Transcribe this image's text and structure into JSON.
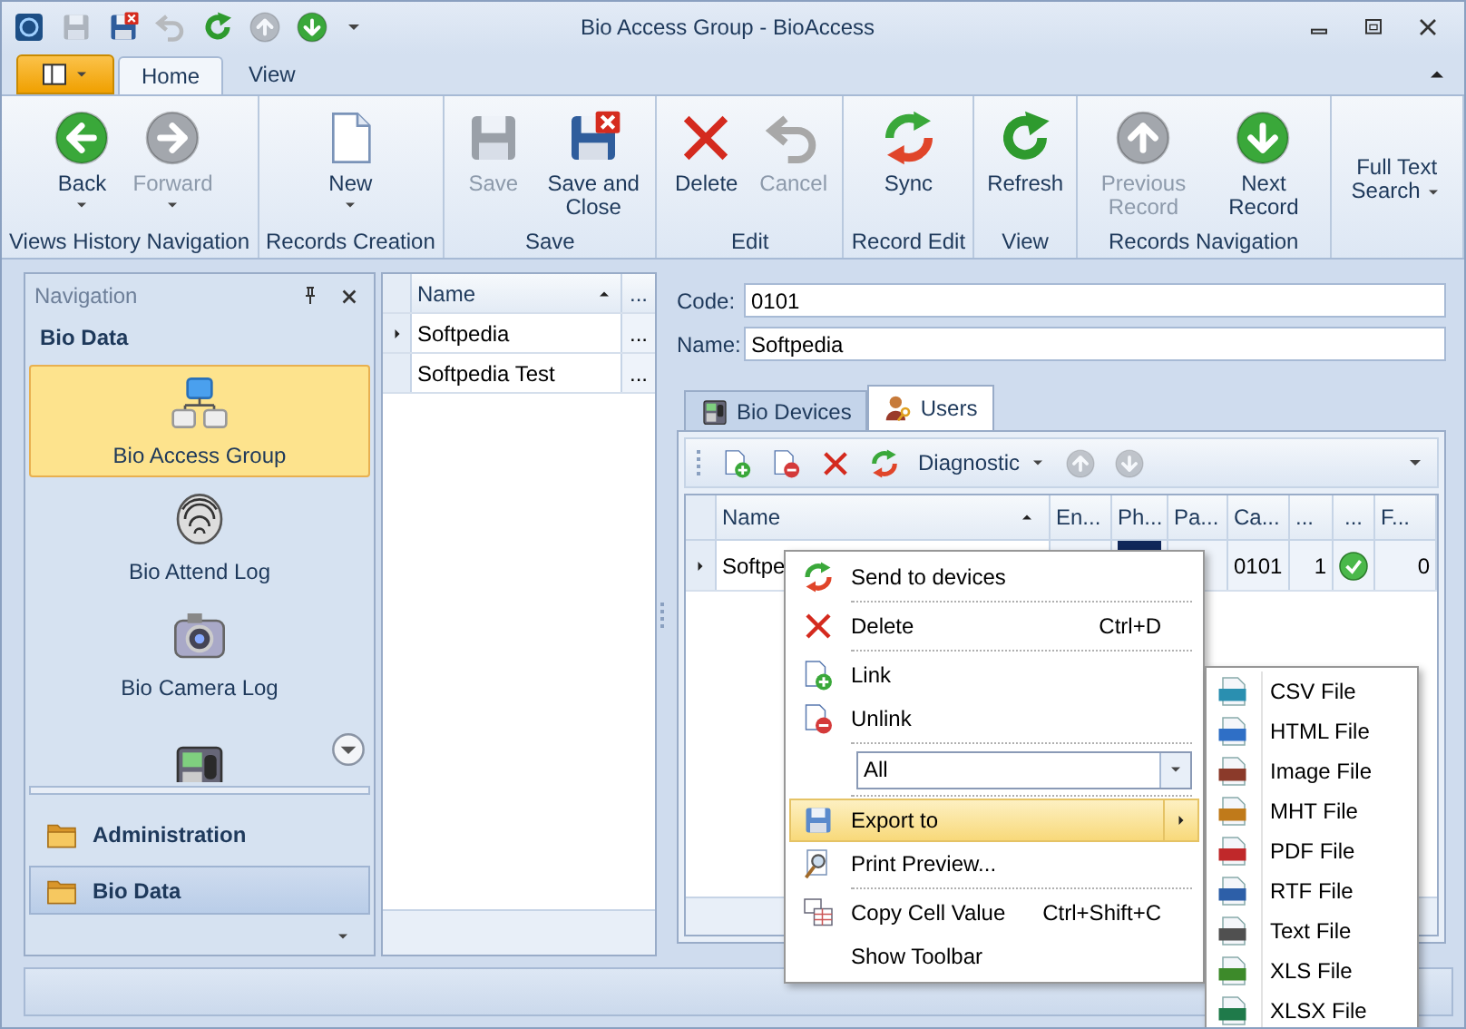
{
  "window": {
    "title": "Bio Access Group - BioAccess"
  },
  "quick_access": [
    {
      "kind": "app",
      "disabled": false
    },
    {
      "kind": "save",
      "disabled": true
    },
    {
      "kind": "save-close",
      "disabled": false
    },
    {
      "kind": "undo",
      "disabled": true
    },
    {
      "kind": "refresh",
      "disabled": false
    },
    {
      "kind": "up",
      "disabled": true
    },
    {
      "kind": "down",
      "disabled": false
    },
    {
      "kind": "customize",
      "disabled": false
    }
  ],
  "ribbon_tabs": [
    {
      "label": "Home",
      "selected": true
    },
    {
      "label": "View",
      "selected": false
    }
  ],
  "ribbon_groups": [
    {
      "label": "Views History Navigation",
      "buttons": [
        {
          "kind": "back",
          "label": "Back",
          "disabled": false,
          "dropdown": true
        },
        {
          "kind": "forward",
          "label": "Forward",
          "disabled": true,
          "dropdown": true
        }
      ]
    },
    {
      "label": "Records Creation",
      "buttons": [
        {
          "kind": "new",
          "label": "New",
          "disabled": false,
          "dropdown": true
        }
      ]
    },
    {
      "label": "Save",
      "buttons": [
        {
          "kind": "save",
          "label": "Save",
          "disabled": true,
          "dropdown": false
        },
        {
          "kind": "save-close",
          "label": "Save and Close",
          "disabled": false,
          "dropdown": false
        }
      ]
    },
    {
      "label": "Edit",
      "buttons": [
        {
          "kind": "delete",
          "label": "Delete",
          "disabled": false,
          "dropdown": false
        },
        {
          "kind": "undo",
          "label": "Cancel",
          "disabled": true,
          "dropdown": false
        }
      ]
    },
    {
      "label": "Record Edit",
      "buttons": [
        {
          "kind": "sync",
          "label": "Sync",
          "disabled": false,
          "dropdown": false
        }
      ]
    },
    {
      "label": "View",
      "buttons": [
        {
          "kind": "refresh",
          "label": "Refresh",
          "disabled": false,
          "dropdown": false
        }
      ]
    },
    {
      "label": "Records Navigation",
      "buttons": [
        {
          "kind": "up",
          "label": "Previous Record",
          "disabled": true,
          "dropdown": false
        },
        {
          "kind": "down",
          "label": "Next Record",
          "disabled": false,
          "dropdown": false
        }
      ]
    },
    {
      "buttons": [
        {
          "kind": "text",
          "label": "Full Text Search",
          "disabled": false,
          "dropdown": true
        }
      ]
    }
  ],
  "navigation": {
    "title": "Navigation",
    "group": "Bio Data",
    "items": [
      {
        "kind": "hierarchy",
        "label": "Bio Access Group",
        "selected": true
      },
      {
        "kind": "fingerprint",
        "label": "Bio Attend Log",
        "selected": false
      },
      {
        "kind": "camera",
        "label": "Bio Camera Log",
        "selected": false
      },
      {
        "kind": "terminal",
        "selected": false
      }
    ],
    "sections": [
      {
        "label": "Administration",
        "selected": false
      },
      {
        "label": "Bio Data",
        "selected": true
      }
    ]
  },
  "list": {
    "columns": [
      "Name",
      "..."
    ],
    "rows": [
      {
        "cells": [
          "Softpedia",
          "..."
        ],
        "current": true
      },
      {
        "cells": [
          "Softpedia Test",
          "..."
        ],
        "current": false
      }
    ]
  },
  "detail": {
    "fields": [
      {
        "label": "Code:",
        "value": "0101"
      },
      {
        "label": "Name:",
        "value": "Softpedia"
      }
    ],
    "tabs": [
      {
        "kind": "device",
        "label": "Bio Devices",
        "selected": false
      },
      {
        "kind": "users",
        "label": "Users",
        "selected": true
      }
    ],
    "toolbar": [
      {
        "kind": "link",
        "disabled": false
      },
      {
        "kind": "unlink",
        "disabled": false
      },
      {
        "kind": "delete",
        "disabled": false
      },
      {
        "kind": "sync",
        "disabled": false
      },
      {
        "kind": "dropdown",
        "label": "Diagnostic",
        "disabled": false
      },
      {
        "kind": "up",
        "disabled": true
      },
      {
        "kind": "down",
        "disabled": true
      }
    ],
    "grid": {
      "columns": [
        "Name",
        "En...",
        "Ph...",
        "Pa...",
        "Ca...",
        "...",
        "...",
        "F..."
      ],
      "rows": [
        {
          "current": true,
          "cells": [
            {
              "kind": "text",
              "text": "Softpe"
            },
            {
              "kind": "empty"
            },
            {
              "kind": "photo"
            },
            {
              "kind": "empty"
            },
            {
              "kind": "text",
              "text": "0101"
            },
            {
              "kind": "number",
              "text": "1"
            },
            {
              "kind": "check"
            },
            {
              "kind": "number",
              "text": "0"
            }
          ]
        }
      ]
    }
  },
  "context_menu": {
    "items": [
      {
        "kind": "sync",
        "label": "Send to devices",
        "selected": false,
        "separator_after": true
      },
      {
        "kind": "delete",
        "label": "Delete",
        "shortcut": "Ctrl+D",
        "selected": false,
        "separator_after": true
      },
      {
        "kind": "link",
        "label": "Link",
        "selected": false,
        "separator_after": false
      },
      {
        "kind": "unlink",
        "label": "Unlink",
        "selected": false,
        "separator_after": true
      },
      {
        "kind": "combo",
        "value": "All",
        "selected": false,
        "separator_after": true
      },
      {
        "kind": "export",
        "label": "Export to",
        "selected": true,
        "separator_after": false
      },
      {
        "kind": "preview",
        "label": "Print Preview...",
        "selected": false,
        "separator_after": true
      },
      {
        "kind": "copy",
        "label": "Copy Cell Value",
        "shortcut": "Ctrl+Shift+C",
        "selected": false,
        "separator_after": false
      },
      {
        "kind": "plain",
        "label": "Show Toolbar",
        "selected": false,
        "separator_after": false
      }
    ]
  },
  "export_menu": [
    {
      "label": "CSV File",
      "color": "#2a8fb0"
    },
    {
      "label": "HTML File",
      "color": "#2f6fc6"
    },
    {
      "label": "Image File",
      "color": "#8b3a2a"
    },
    {
      "label": "MHT File",
      "color": "#c07a1a"
    },
    {
      "label": "PDF File",
      "color": "#c0282a"
    },
    {
      "label": "RTF File",
      "color": "#2d5fa8"
    },
    {
      "label": "Text File",
      "color": "#505050"
    },
    {
      "label": "XLS File",
      "color": "#3d8a2a"
    },
    {
      "label": "XLSX File",
      "color": "#1f7a4a"
    }
  ]
}
